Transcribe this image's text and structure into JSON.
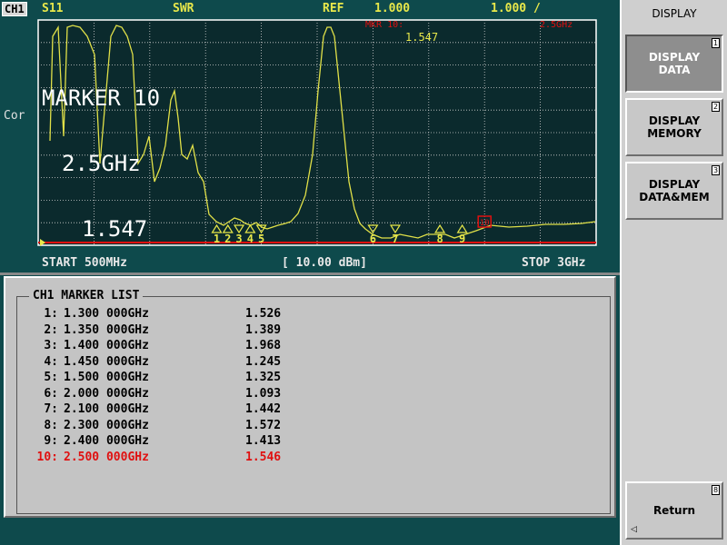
{
  "header": {
    "channel": "CH1",
    "param": "S11",
    "format": "SWR",
    "ref_label": "REF",
    "ref_value": "1.000",
    "scale": "1.000 /",
    "marker_readout_label": "MKR 10:",
    "marker_readout_freq": "2.5GHz",
    "marker_readout_value": "1.547",
    "colors": {
      "header": "#e8e84a",
      "trace": "#e0e048",
      "active": "#e01010",
      "grid": "#ffffff"
    }
  },
  "status": {
    "cor": "Cor"
  },
  "marker_display": {
    "line1": "MARKER 10",
    "line2": "2.5GHz",
    "line3": "1.547"
  },
  "footer": {
    "start": "START 500MHz",
    "power": "[ 10.00 dBm]",
    "stop": "STOP 3GHz"
  },
  "marker_list": {
    "title": "CH1 MARKER LIST",
    "rows": [
      {
        "idx": "1:",
        "freq": "1.300 000GHz",
        "val": "1.526"
      },
      {
        "idx": "2:",
        "freq": "1.350 000GHz",
        "val": "1.389"
      },
      {
        "idx": "3:",
        "freq": "1.400 000GHz",
        "val": "1.968"
      },
      {
        "idx": "4:",
        "freq": "1.450 000GHz",
        "val": "1.245"
      },
      {
        "idx": "5:",
        "freq": "1.500 000GHz",
        "val": "1.325"
      },
      {
        "idx": "6:",
        "freq": "2.000 000GHz",
        "val": "1.093"
      },
      {
        "idx": "7:",
        "freq": "2.100 000GHz",
        "val": "1.442"
      },
      {
        "idx": "8:",
        "freq": "2.300 000GHz",
        "val": "1.572"
      },
      {
        "idx": "9:",
        "freq": "2.400 000GHz",
        "val": "1.413"
      },
      {
        "idx": "10:",
        "freq": "2.500 000GHz",
        "val": "1.546"
      }
    ]
  },
  "plot": {
    "markers": [
      {
        "label": "1",
        "f": 1.3,
        "dir": "up"
      },
      {
        "label": "2",
        "f": 1.35,
        "dir": "up"
      },
      {
        "label": "3",
        "f": 1.4,
        "dir": "down"
      },
      {
        "label": "4",
        "f": 1.45,
        "dir": "up"
      },
      {
        "label": "5",
        "f": 1.5,
        "dir": "down"
      },
      {
        "label": "6",
        "f": 2.0,
        "dir": "down"
      },
      {
        "label": "7",
        "f": 2.1,
        "dir": "down"
      },
      {
        "label": "8",
        "f": 2.3,
        "dir": "up"
      },
      {
        "label": "9",
        "f": 2.4,
        "dir": "up"
      },
      {
        "label": "10",
        "f": 2.5,
        "dir": "active"
      }
    ]
  },
  "softkeys": {
    "title": "DISPLAY",
    "buttons": [
      {
        "label": "DISPLAY\nDATA",
        "num": "1"
      },
      {
        "label": "DISPLAY\nMEMORY",
        "num": "2"
      },
      {
        "label": "DISPLAY\nDATA&MEM",
        "num": "3"
      }
    ],
    "return_label": "Return",
    "return_num": "8"
  }
}
